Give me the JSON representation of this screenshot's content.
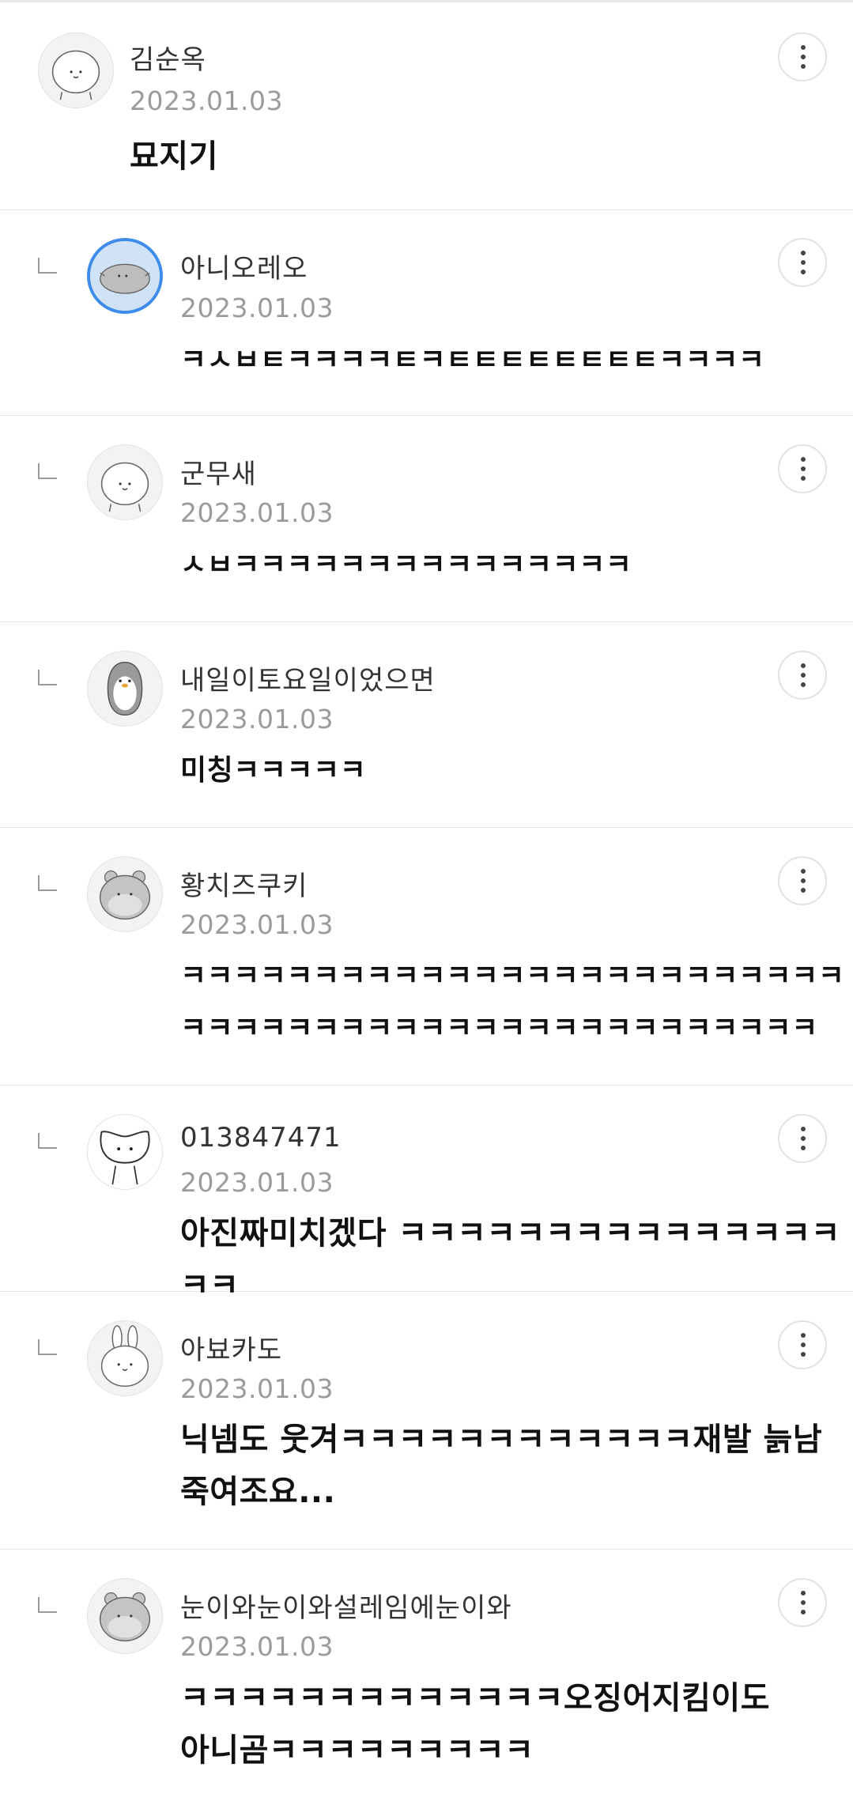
{
  "comments": [
    {
      "nickname": "김순옥",
      "date": "2023.01.03",
      "text": "묘지기",
      "avatar_icon": "face-icon"
    },
    {
      "nickname": "아니오레오",
      "date": "2023.01.03",
      "text": "ㅋㅅㅂㅌㅋㅋㅋㅋㅌㅋㅌㅌㅌㅌㅌㅌㅌㅌㅋㅋㅋㅋ",
      "avatar_icon": "mole-icon"
    },
    {
      "nickname": "군무새",
      "date": "2023.01.03",
      "text": "ㅅㅂㅋㅋㅋㅋㅋㅋㅋㅋㅋㅋㅋㅋㅋㅋㅋ",
      "avatar_icon": "face-icon"
    },
    {
      "nickname": "내일이토요일이었으면",
      "date": "2023.01.03",
      "text": "미칭ㅋㅋㅋㅋㅋ",
      "avatar_icon": "penguin-icon"
    },
    {
      "nickname": "황치즈쿠키",
      "date": "2023.01.03",
      "text_lines": [
        "ㅋㅋㅋㅋㅋㅋㅋㅋㅋㅋㅋㅋㅋㅋㅋㅋㅋㅋㅋㅋㅋㅋㅋㅋㅋㅋㅋㅋㅋㅋㅋ",
        "ㅋㅋㅋㅋㅋㅋㅋㅋㅋㅋㅋㅋㅋㅋㅋㅋㅋㅋㅋㅋㅋㅋㅋㅋ"
      ],
      "avatar_icon": "hamster-icon"
    },
    {
      "nickname": "013847471",
      "date": "2023.01.03",
      "text": "아진짜미치겠다 ㅋㅋㅋㅋㅋㅋㅋㅋㅋㅋㅋㅋㅋㅋㅋㅋㅋ",
      "avatar_icon": "cat-icon"
    },
    {
      "nickname": "아뵤카도",
      "date": "2023.01.03",
      "text_lines": [
        "닉넴도 웃겨ㅋㅋㅋㅋㅋㅋㅋㅋㅋㅋㅋㅋ재발 늙남",
        "죽여조요..."
      ],
      "avatar_icon": "rabbit-icon"
    },
    {
      "nickname": "눈이와눈이와설레임에눈이와",
      "date": "2023.01.03",
      "text_lines": [
        "ㅋㅋㅋㅋㅋㅋㅋㅋㅋㅋㅋㅋㅋ오징어지킴이도",
        "아니곰ㅋㅋㅋㅋㅋㅋㅋㅋㅋ"
      ],
      "avatar_icon": "hamster-icon"
    }
  ]
}
